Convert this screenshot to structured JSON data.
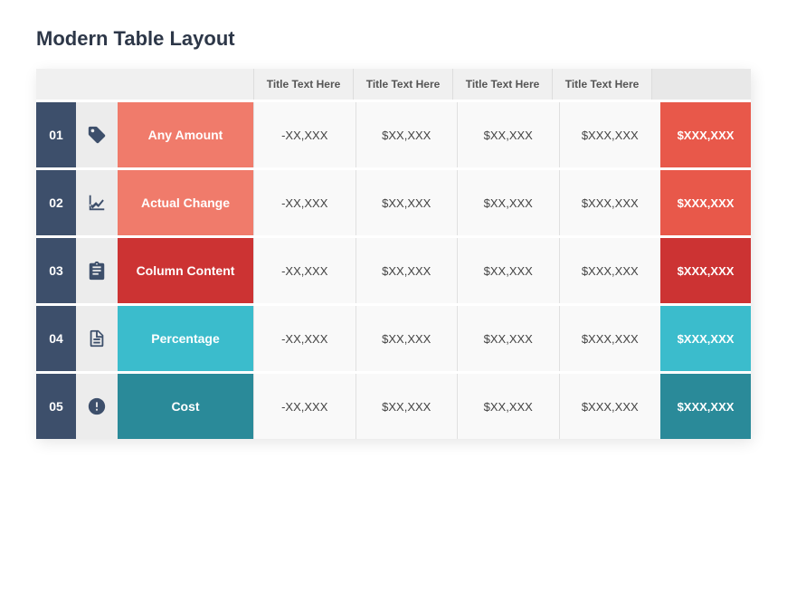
{
  "page": {
    "title": "Modern Table Layout"
  },
  "header": {
    "columns": [
      "Title Text Here",
      "Title Text Here",
      "Title Text Here",
      "Title Text Here"
    ]
  },
  "rows": [
    {
      "num": "01",
      "icon": "tag",
      "label": "Any Amount",
      "labelColor": "salmon",
      "finalColor": "salmon-dark",
      "cells": [
        "-XX,XXX",
        "$XX,XXX",
        "$XX,XXX",
        "$XXX,XXX"
      ],
      "final": "$XXX,XXX"
    },
    {
      "num": "02",
      "icon": "chart",
      "label": "Actual Change",
      "labelColor": "salmon",
      "finalColor": "salmon-dark",
      "cells": [
        "-XX,XXX",
        "$XX,XXX",
        "$XX,XXX",
        "$XXX,XXX"
      ],
      "final": "$XXX,XXX"
    },
    {
      "num": "03",
      "icon": "clipboard",
      "label": "Column Content",
      "labelColor": "red",
      "finalColor": "red",
      "cells": [
        "-XX,XXX",
        "$XX,XXX",
        "$XX,XXX",
        "$XXX,XXX"
      ],
      "final": "$XXX,XXX"
    },
    {
      "num": "04",
      "icon": "document",
      "label": "Percentage",
      "labelColor": "teal-light",
      "finalColor": "teal-light",
      "cells": [
        "-XX,XXX",
        "$XX,XXX",
        "$XX,XXX",
        "$XXX,XXX"
      ],
      "final": "$XXX,XXX"
    },
    {
      "num": "05",
      "icon": "coins",
      "label": "Cost",
      "labelColor": "teal",
      "finalColor": "teal",
      "cells": [
        "-XX,XXX",
        "$XX,XXX",
        "$XX,XXX",
        "$XXX,XXX"
      ],
      "final": "$XXX,XXX"
    }
  ]
}
